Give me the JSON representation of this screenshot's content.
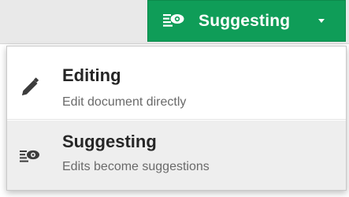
{
  "mode_button": {
    "label": "Suggesting",
    "icon": "suggest-icon",
    "caret_icon": "caret-down-icon",
    "color": "#0f9d58"
  },
  "menu": {
    "items": [
      {
        "title": "Editing",
        "description": "Edit document directly",
        "icon": "pencil-icon"
      },
      {
        "title": "Suggesting",
        "description": "Edits become suggestions",
        "icon": "suggest-icon",
        "highlighted": true
      }
    ]
  }
}
